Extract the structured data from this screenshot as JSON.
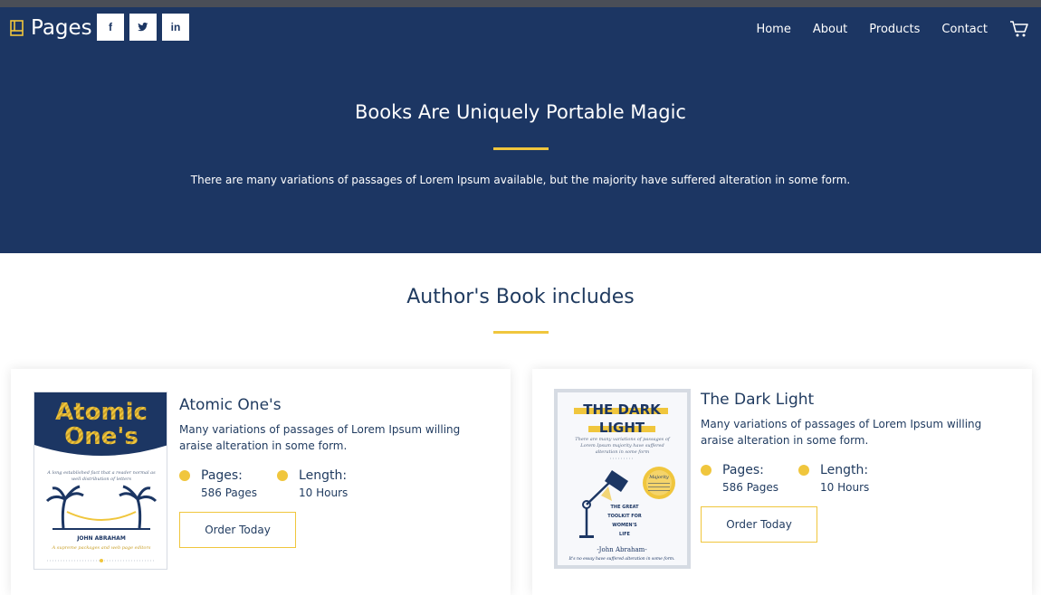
{
  "brand": {
    "name": "Pages"
  },
  "social": [
    {
      "label": "f",
      "icon": "facebook-icon"
    },
    {
      "label": "t",
      "icon": "twitter-icon"
    },
    {
      "label": "in",
      "icon": "linkedin-icon"
    }
  ],
  "nav": {
    "items": [
      "Home",
      "About",
      "Products",
      "Contact"
    ],
    "cart_icon": "cart-icon"
  },
  "hero": {
    "title": "Books Are Uniquely Portable Magic",
    "subtitle": "There are many variations of passages of Lorem Ipsum available, but the majority have suffered alteration in some form."
  },
  "section": {
    "title": "Author's Book includes"
  },
  "books": [
    {
      "title": "Atomic One's",
      "description": "Many variations of passages of Lorem Ipsum willing araise alteration in some form.",
      "pages_label": "Pages:",
      "pages_value": "586 Pages",
      "length_label": "Length:",
      "length_value": "10 Hours",
      "button": "Order Today",
      "cover": {
        "title_line1": "Atomic",
        "title_line2": "One's",
        "blurb": "A long established fact that a reader normal as well distribution of letters",
        "author": "JOHN ABRAHAM",
        "tagline": "A supreme packages and web page editors"
      }
    },
    {
      "title": "The Dark Light",
      "description": "Many variations of passages of Lorem Ipsum willing araise alteration in some form.",
      "pages_label": "Pages:",
      "pages_value": "586 Pages",
      "length_label": "Length:",
      "length_value": "10 Hours",
      "button": "Order Today",
      "cover": {
        "title_line1": "THE DARK",
        "title_line2": "LIGHT",
        "blurb": "There are many variations of passages of Lorem Ipsum majority have suffered alteration in some form",
        "badge": "Majority",
        "sub_line1": "THE GREAT",
        "sub_line2": "TOOLKIT FOR",
        "sub_line3": "WOMEN'S",
        "sub_line4": "LIFE",
        "author": "-John Abraham-",
        "tagline": "It's no essay have suffered alteration in some form."
      }
    }
  ],
  "colors": {
    "navy": "#1c3663",
    "accent": "#f0c63d",
    "text": "#1f3a5f"
  }
}
